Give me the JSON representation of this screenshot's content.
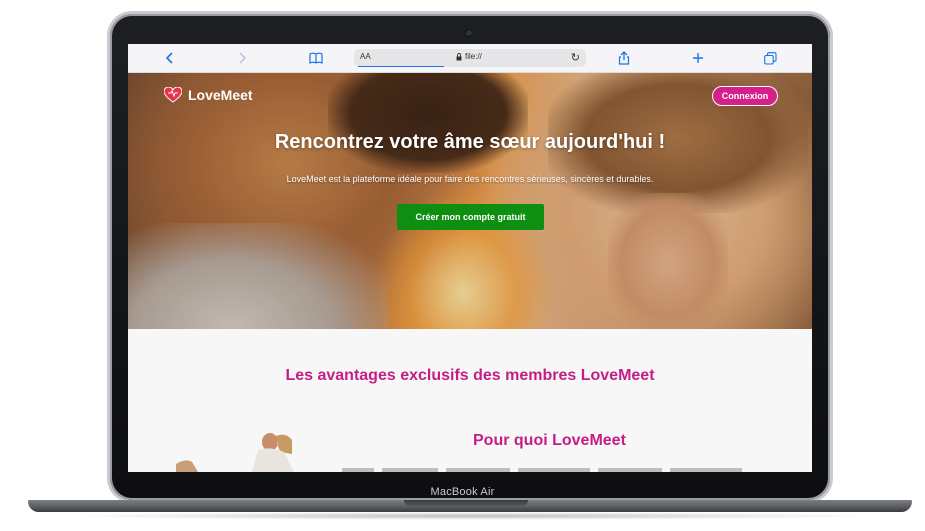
{
  "device": {
    "label": "MacBook Air"
  },
  "browser": {
    "aa_label": "AA",
    "url": "file://",
    "icons": [
      "back-icon",
      "forward-icon",
      "bookmarks-icon",
      "lock-icon",
      "reload-icon",
      "share-icon",
      "new-tab-icon",
      "tabs-icon"
    ]
  },
  "site": {
    "logo_text": "LoveMeet",
    "login_label": "Connexion",
    "hero": {
      "title": "Rencontrez votre âme sœur aujourd'hui !",
      "subtitle": "LoveMeet est la plateforme idéale pour faire des rencontres sérieuses, sincères et durables.",
      "cta_label": "Créer mon compte gratuit"
    },
    "advantages_title": "Les avantages exclusifs des membres LoveMeet",
    "why_title": "Pour quoi LoveMeet"
  },
  "colors": {
    "accent": "#d61f88",
    "heading": "#c41e86",
    "cta": "#0e8f12",
    "browser_blue": "#1a73e8"
  }
}
